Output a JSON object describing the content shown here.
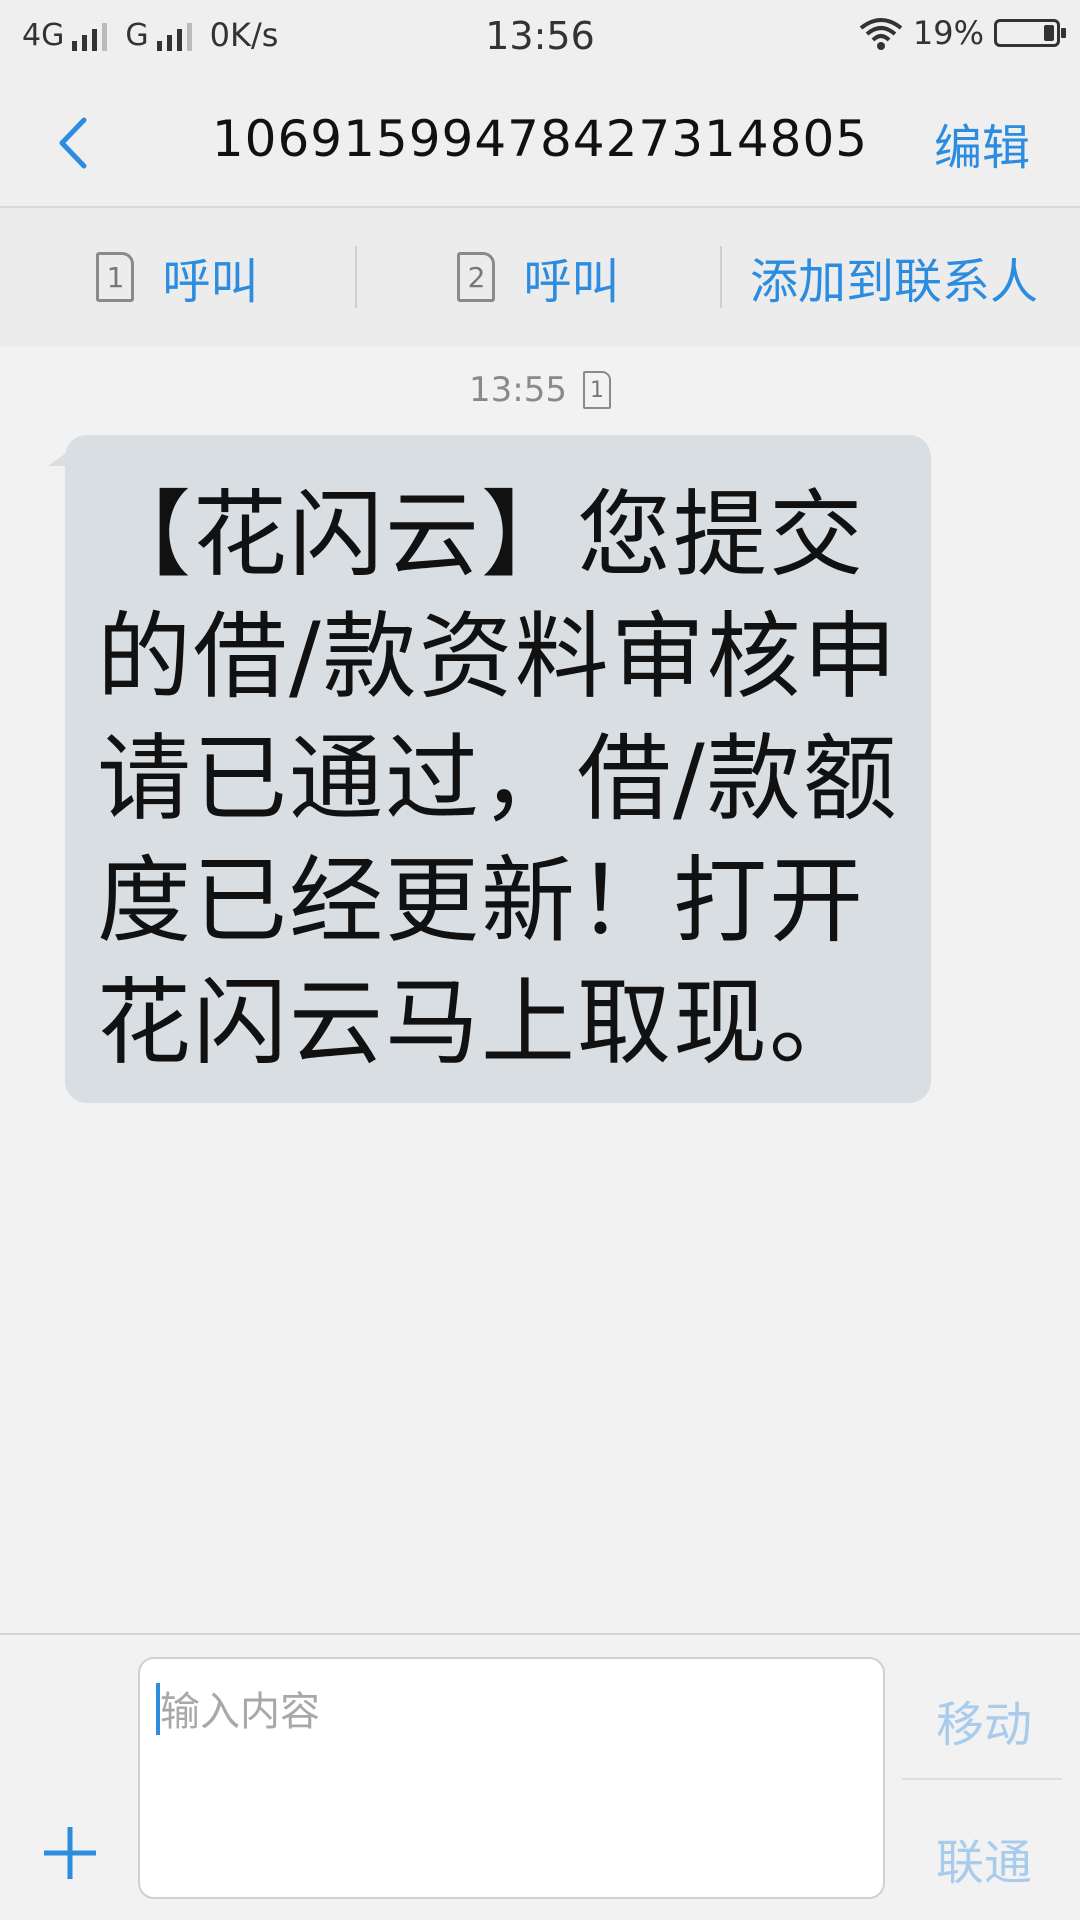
{
  "status_bar": {
    "network_1": "4G",
    "network_2": "G",
    "speed": "0K/s",
    "time": "13:56",
    "battery": "19%",
    "battery_level": 0.19,
    "wifi_icon": "wifi-icon",
    "signal_icon": "signal-bars-icon"
  },
  "header": {
    "back_icon": "chevron-left-icon",
    "title": "1069159947842731​4805",
    "edit_label": "编辑"
  },
  "actions": {
    "call_sim1": {
      "sim": "1",
      "label": "呼叫"
    },
    "call_sim2": {
      "sim": "2",
      "label": "呼叫"
    },
    "add_contact": "添加到联系人"
  },
  "conversation": {
    "timestamp": "13:55",
    "sim": "1",
    "message": "【花闪云】您提交的借/款资料审核申请已通过，借/款额度已经更新！打开花闪云马上取现。"
  },
  "compose": {
    "placeholder": "输入内容",
    "carrier_1": "移动",
    "carrier_2": "联通",
    "plus_icon": "plus-icon"
  },
  "colors": {
    "accent": "#2b8ce0",
    "bubble": "#d9dee2",
    "background": "#f2f2f2"
  }
}
